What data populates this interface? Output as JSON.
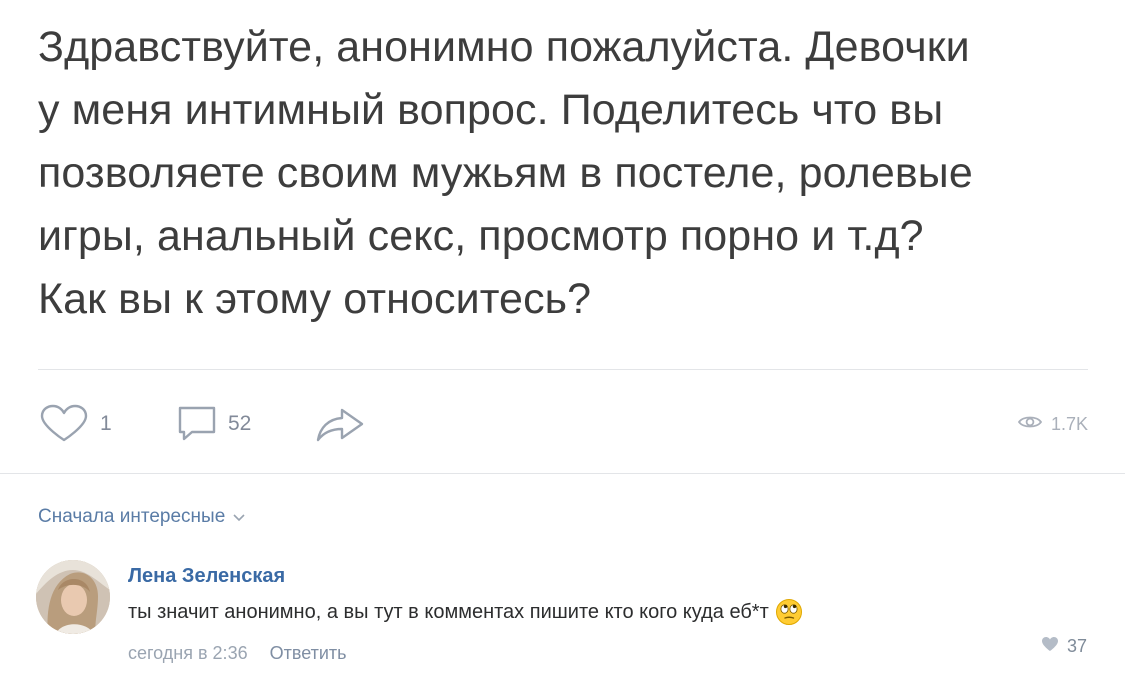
{
  "post": {
    "lines": [
      "Здравствуйте, анонимно пожалуйста. Девочки",
      "у меня интимный вопрос. Поделитесь что вы",
      "позволяете своим мужьям в постеле, ролевые",
      "игры, анальный секс, просмотр порно и т.д?",
      "Как вы к этому относитесь?"
    ]
  },
  "actions": {
    "likes": "1",
    "comments": "52",
    "views": "1.7K",
    "icons": [
      "heart-icon",
      "comment-icon",
      "share-icon",
      "eye-icon"
    ]
  },
  "comments_section": {
    "sort_label": "Сначала интересные",
    "sort_icon": "chevron-down-icon"
  },
  "comment": {
    "author": "Лена Зеленская",
    "text": "ты значит анонимно, а вы тут в комментах пишите кто кого куда еб*т",
    "emoji": "rolling-eyes-emoji",
    "time": "сегодня в 2:36",
    "reply_label": "Ответить",
    "likes": "37"
  },
  "colors": {
    "post_text": "#3d3d3d",
    "link": "#3a6aa5",
    "muted": "#828a99",
    "divider": "#e3e5e8"
  }
}
